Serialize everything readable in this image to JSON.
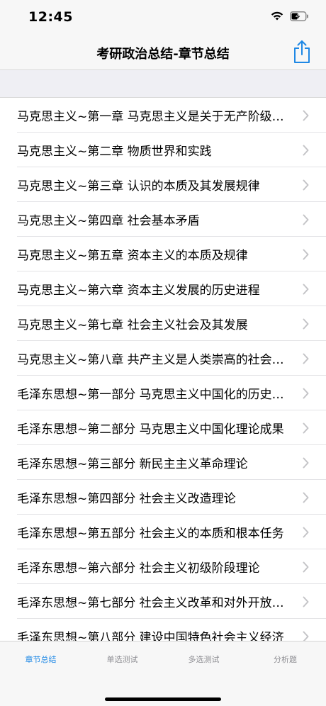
{
  "status_bar": {
    "time": "12:45",
    "icons": [
      "wifi-icon",
      "battery-charging-icon"
    ]
  },
  "nav": {
    "title": "考研政治总结-章节总结",
    "share_icon": "share-icon"
  },
  "colors": {
    "accent": "#1e88e5",
    "tab_inactive": "#8e8e93",
    "section_bg": "#efeff4",
    "bar_bg": "#f7f7f7"
  },
  "chapters": [
    "马克思主义~第一章 马克思主义是关于无产阶级和人类解放的科学",
    "马克思主义~第二章 物质世界和实践",
    "马克思主义~第三章 认识的本质及其发展规律",
    "马克思主义~第四章 社会基本矛盾",
    "马克思主义~第五章 资本主义的本质及规律",
    "马克思主义~第六章 资本主义发展的历史进程",
    "马克思主义~第七章 社会主义社会及其发展",
    "马克思主义~第八章 共产主义是人类崇高的社会理想",
    "毛泽东思想~第一部分 马克思主义中国化的历史进程",
    "毛泽东思想~第二部分 马克思主义中国化理论成果",
    "毛泽东思想~第三部分 新民主主义革命理论",
    "毛泽东思想~第四部分 社会主义改造理论",
    "毛泽东思想~第五部分 社会主义的本质和根本任务",
    "毛泽东思想~第六部分 社会主义初级阶段理论",
    "毛泽东思想~第七部分 社会主义改革和对外开放理论",
    "毛泽东思想~第八部分 建设中国特色社会主义经济"
  ],
  "tabs": [
    {
      "label": "章节总结",
      "active": true
    },
    {
      "label": "单选测试",
      "active": false
    },
    {
      "label": "多选测试",
      "active": false
    },
    {
      "label": "分析题",
      "active": false
    }
  ]
}
